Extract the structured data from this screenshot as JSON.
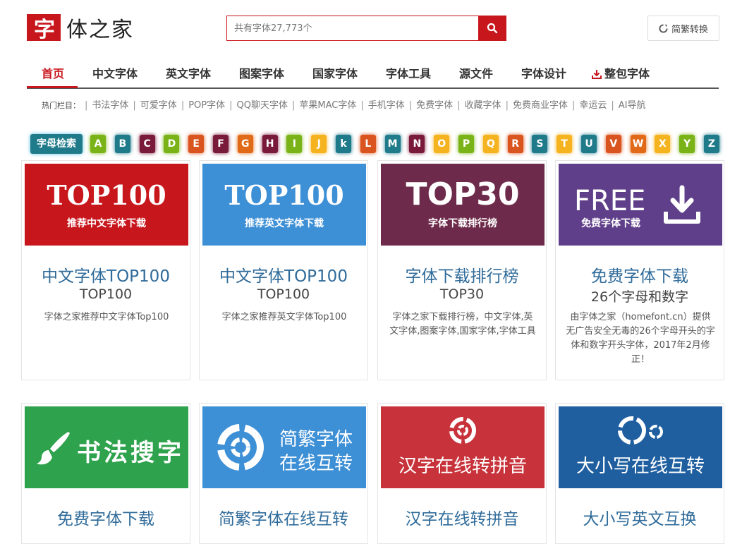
{
  "logo": {
    "mark": "字",
    "text": "体之家"
  },
  "search": {
    "placeholder": "共有字体27,773个"
  },
  "convert_button": {
    "label": "简繁转换"
  },
  "nav": {
    "items": [
      "首页",
      "中文字体",
      "英文字体",
      "图案字体",
      "国家字体",
      "字体工具",
      "源文件",
      "字体设计",
      "整包字体"
    ]
  },
  "hot": {
    "label": "热门栏目：",
    "links": [
      "书法字体",
      "可爱字体",
      "POP字体",
      "QQ聊天字体",
      "苹果MAC字体",
      "手机字体",
      "免费字体",
      "收藏字体",
      "免费商业字体",
      "幸运云",
      "AI导航"
    ]
  },
  "letters": {
    "title": "字母检索",
    "items": [
      {
        "ch": "A",
        "color": "#7ab317"
      },
      {
        "ch": "B",
        "color": "#1f7a8a"
      },
      {
        "ch": "C",
        "color": "#7a1a3a"
      },
      {
        "ch": "D",
        "color": "#7ab317"
      },
      {
        "ch": "E",
        "color": "#d9541e"
      },
      {
        "ch": "F",
        "color": "#7a1a3a"
      },
      {
        "ch": "G",
        "color": "#e06a17"
      },
      {
        "ch": "H",
        "color": "#7a1a3a"
      },
      {
        "ch": "I",
        "color": "#7ab317"
      },
      {
        "ch": "J",
        "color": "#f5b320"
      },
      {
        "ch": "k",
        "color": "#1f7a8a"
      },
      {
        "ch": "L",
        "color": "#d9541e"
      },
      {
        "ch": "M",
        "color": "#1f7a8a"
      },
      {
        "ch": "N",
        "color": "#7a1a3a"
      },
      {
        "ch": "O",
        "color": "#f5b320"
      },
      {
        "ch": "P",
        "color": "#7ab317"
      },
      {
        "ch": "Q",
        "color": "#f5b320"
      },
      {
        "ch": "R",
        "color": "#d9541e"
      },
      {
        "ch": "S",
        "color": "#1f7a8a"
      },
      {
        "ch": "T",
        "color": "#f5b320"
      },
      {
        "ch": "U",
        "color": "#1f7a8a"
      },
      {
        "ch": "V",
        "color": "#d9541e"
      },
      {
        "ch": "W",
        "color": "#e06a17"
      },
      {
        "ch": "X",
        "color": "#f5b320"
      },
      {
        "ch": "Y",
        "color": "#7ab317"
      },
      {
        "ch": "Z",
        "color": "#1f7a8a"
      }
    ]
  },
  "cards": [
    {
      "banner": {
        "big": "TOP100",
        "sub": "推荐中文字体下载",
        "color": "#c8161d"
      },
      "title": "中文字体TOP100",
      "subtitle": "TOP100",
      "desc": "字体之家推荐中文字体Top100"
    },
    {
      "banner": {
        "big": "TOP100",
        "sub": "推荐英文字体下载",
        "color": "#3d8fd6"
      },
      "title": "中文字体TOP100",
      "subtitle": "TOP100",
      "desc": "字体之家推荐英文字体Top100"
    },
    {
      "banner": {
        "big": "TOP30",
        "sub": "字体下载排行榜",
        "color": "#6e2a4a"
      },
      "title": "字体下载排行榜",
      "subtitle": "TOP30",
      "desc": "字体之家下载排行榜，中文字体,英文字体,图案字体,国家字体,字体工具"
    },
    {
      "banner": {
        "big": "FREE",
        "sub": "免费字体下载",
        "color": "#5f3f8a"
      },
      "title": "免费字体下载",
      "subtitle": "26个字母和数字",
      "desc": "由字体之家（homefont.cn）提供无广告安全无毒的26个字母开头的字体和数字开头字体，2017年2月修正！"
    },
    {
      "banner": {
        "big": "书法搜字",
        "color": "#2fa24d"
      },
      "title": "免费字体下载"
    },
    {
      "banner": {
        "big": "简繁字体",
        "big2": "在线互转",
        "color": "#3d8fd6"
      },
      "title": "简繁字体在线互转"
    },
    {
      "banner": {
        "big": "汉字在线转拼音",
        "color": "#c8323a"
      },
      "title": "汉字在线转拼音"
    },
    {
      "banner": {
        "big": "大小写在线互转",
        "color": "#1f5fa0"
      },
      "title": "大小写英文互换"
    }
  ]
}
